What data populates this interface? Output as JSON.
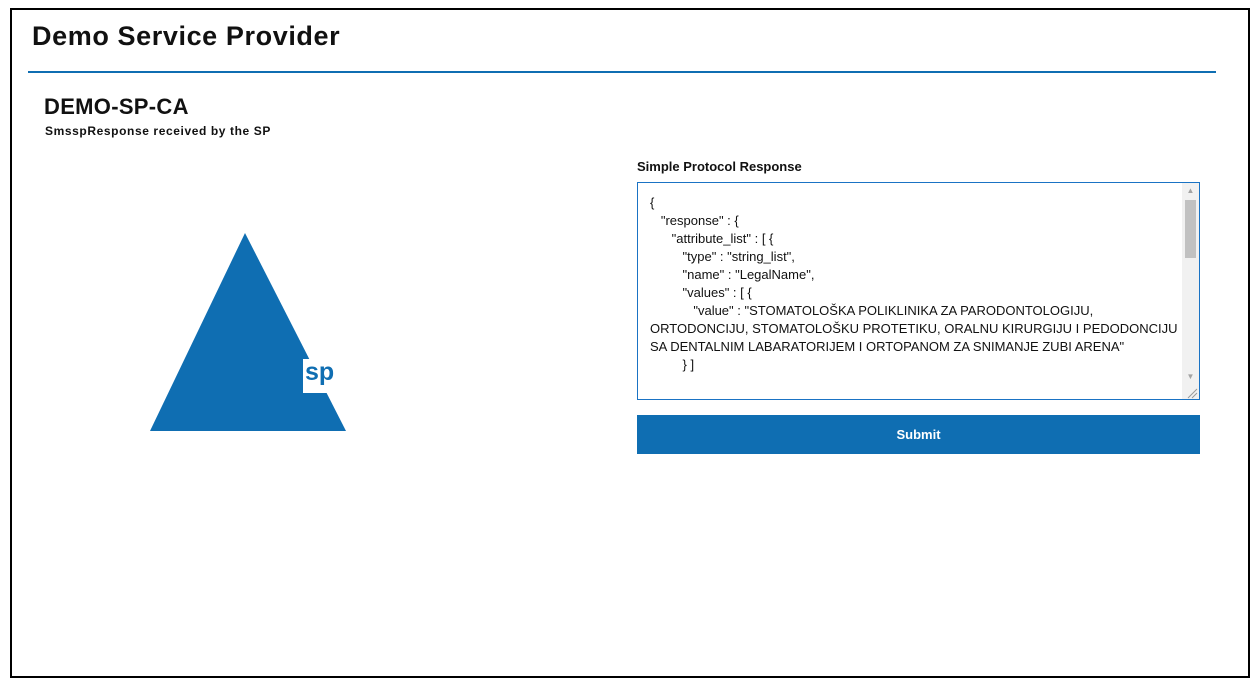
{
  "header": {
    "app_title": "Demo Service Provider"
  },
  "page": {
    "title": "DEMO-SP-CA",
    "subtitle": "SmsspResponse received by the SP"
  },
  "logo": {
    "text": "sp",
    "icon": "triangle-logo-icon",
    "color": "#0f6eb2"
  },
  "form": {
    "label": "Simple Protocol Response",
    "response_text": "{\n   \"response\" : {\n      \"attribute_list\" : [ {\n         \"type\" : \"string_list\",\n         \"name\" : \"LegalName\",\n         \"values\" : [ {\n            \"value\" : \"STOMATOLOŠKA POLIKLINIKA ZA PARODONTOLOGIJU, ORTODONCIJU, STOMATOLOŠKU PROTETIKU, ORALNU KIRURGIJU I PEDODONCIJU SA DENTALNIM LABARATORIJEM I ORTOPANOM ZA SNIMANJE ZUBI ARENA\"\n         } ]",
    "submit_label": "Submit"
  },
  "colors": {
    "accent": "#0f6eb2",
    "textarea_border": "#1a73c4"
  }
}
